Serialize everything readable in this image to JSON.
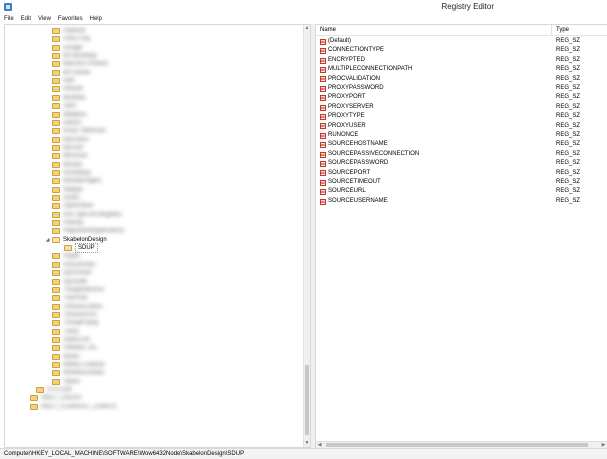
{
  "window": {
    "title": "Registry Editor"
  },
  "menu": [
    "File",
    "Edit",
    "View",
    "Favorites",
    "Help"
  ],
  "tree": {
    "blurred_above": [
      "PlatforM",
      "Polcs Pnp",
      "Google",
      "Mx Bredwrgl",
      "Marcstcl Pnuwrd",
      "MrTlmwes",
      "Intel",
      "Infisclle",
      "Mozlllaa",
      "Java",
      "Ntkllplclc",
      "Ebinos",
      "KiSoc Sdfmcuro",
      "Mercutivs",
      "Mircrolt",
      "Mlcrosoo",
      "Mozilla",
      "mozillaorg",
      "MozillaPlugins",
      "Nettpar",
      "ODBC",
      "OpenOffice",
      "PDF lpdt Ind Mngrtion",
      "Policies",
      "RegisteredApplications"
    ],
    "expanded_parent": "SkabelonDesign",
    "selected": "SDUP",
    "blurred_below": [
      "Skype",
      "SourceGear",
      "SyncHistor",
      "SynSoftk",
      "Thingameinrucr",
      "TinyScan",
      "TortoiseCrdnor",
      "TortoiseSVN",
      "ThreadFlying",
      "Trend",
      "VideoLAN",
      "VMware, Inc.",
      "Winflx",
      "WebEx Outlook",
      "Wow6432Node",
      "Yahoo"
    ],
    "roots_below": [
      "SYSTEM",
      "HKEY_USERS",
      "HKEY_CURRENT_CONFIG"
    ]
  },
  "list": {
    "columns": [
      "Name",
      "Type"
    ],
    "rows": [
      {
        "name": "(Default)",
        "type": "REG_SZ"
      },
      {
        "name": "CONNECTIONTYPE",
        "type": "REG_SZ"
      },
      {
        "name": "ENCRYPTED",
        "type": "REG_SZ"
      },
      {
        "name": "MULTIPLECONNECTIONPATH",
        "type": "REG_SZ"
      },
      {
        "name": "PROCVALIDATION",
        "type": "REG_SZ"
      },
      {
        "name": "PROXYPASSWORD",
        "type": "REG_SZ"
      },
      {
        "name": "PROXYPORT",
        "type": "REG_SZ"
      },
      {
        "name": "PROXYSERVER",
        "type": "REG_SZ"
      },
      {
        "name": "PROXYTYPE",
        "type": "REG_SZ"
      },
      {
        "name": "PROXYUSER",
        "type": "REG_SZ"
      },
      {
        "name": "RUNONCE",
        "type": "REG_SZ"
      },
      {
        "name": "SOURCEHOSTNAME",
        "type": "REG_SZ"
      },
      {
        "name": "SOURCEPASSIVECONNECTION",
        "type": "REG_SZ"
      },
      {
        "name": "SOURCEPASSWORD",
        "type": "REG_SZ"
      },
      {
        "name": "SOURCEPORT",
        "type": "REG_SZ"
      },
      {
        "name": "SOURCETIMEOUT",
        "type": "REG_SZ"
      },
      {
        "name": "SOURCEURL",
        "type": "REG_SZ"
      },
      {
        "name": "SOURCEUSERNAME",
        "type": "REG_SZ"
      }
    ]
  },
  "status": {
    "path": "Computer\\HKEY_LOCAL_MACHINE\\SOFTWARE\\Wow6432Node\\SkabelonDesign\\SDUP"
  },
  "icons": {
    "app": "registry-editor-icon",
    "folder": "folder-icon",
    "value": "string-value-icon"
  }
}
